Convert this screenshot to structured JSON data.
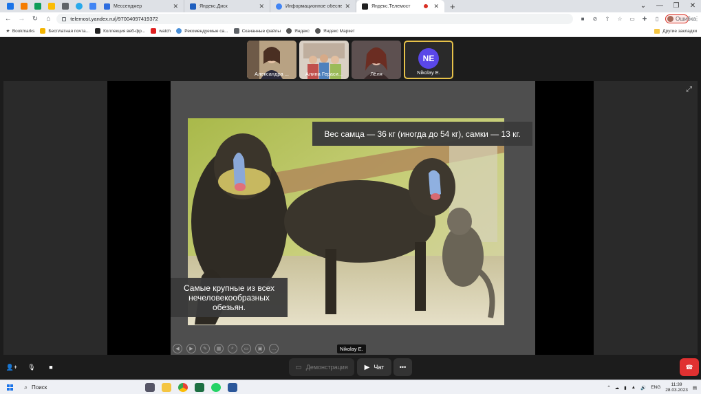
{
  "browser": {
    "tabs": [
      {
        "title": "Мессенджер",
        "favicon_color": "#2d6cdf"
      },
      {
        "title": "Яндекс.Диск",
        "favicon_color": "#1e5fbf"
      },
      {
        "title": "Информационное обеспечени...",
        "favicon_color": "#4285f4"
      },
      {
        "title": "Яндекс.Телемост",
        "favicon_color": "#222222",
        "active": true,
        "recording": true
      }
    ],
    "newtab_label": "+",
    "url": "telemost.yandex.ru/j/97004097419372",
    "profile_status": "Ошибка",
    "bookmarks": [
      "Bookmarks",
      "Бесплатная почта...",
      "Коллекция веб-фр...",
      "watch",
      "Рекомендуемые са...",
      "Скачанные файлы",
      "Яндекс",
      "Яндекс Маркет"
    ],
    "bookmarks_other": "Другие закладки"
  },
  "participants": [
    {
      "name": "Александра ..."
    },
    {
      "name": "Алина Гераси..."
    },
    {
      "name": "Лёля"
    },
    {
      "name": "Nikolay E.",
      "initials": "NE",
      "avatar_color": "#5a47e8",
      "active_speaker": true
    }
  ],
  "slide": {
    "caption_top": "Вес самца — 36 кг (иногда до 54 кг), самки — 13 кг.",
    "caption_bottom": "Самые крупные из всех нечеловекообразных обезьян."
  },
  "presenter_label": "Nikolay E.",
  "controls": {
    "demo_label": "Демонстрация",
    "chat_label": "Чат",
    "more_label": "•••"
  },
  "taskbar": {
    "search_label": "Поиск",
    "lang": "ENG",
    "time": "11:39",
    "date": "28.03.2023"
  }
}
